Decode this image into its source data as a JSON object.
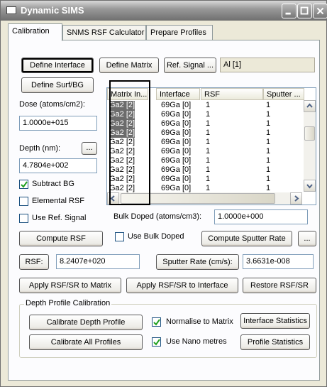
{
  "window": {
    "title": "Dynamic SIMS"
  },
  "tabs": [
    "Calibration",
    "SNMS RSF Calculator",
    "Prepare Profiles"
  ],
  "toolbar": {
    "define_interface": "Define Interface",
    "define_matrix": "Define Matrix",
    "ref_signal": "Ref. Signal ...",
    "ref_signal_value": "Al [1]",
    "define_surf_bg": "Define Surf/BG"
  },
  "left": {
    "dose_label": "Dose (atoms/cm2):",
    "dose_value": "1.0000e+015",
    "depth_label": "Depth (nm):",
    "depth_btn": "...",
    "depth_value": "4.7804e+002",
    "subtract_bg": "Subtract BG",
    "elemental_rsf": "Elemental RSF",
    "use_ref_signal": "Use Ref. Signal"
  },
  "table": {
    "headers": [
      "Matrix In...",
      "Interface",
      "RSF",
      "Sputter ..."
    ],
    "rows": [
      [
        "Ga2 [2]",
        "69Ga [0]",
        "1",
        "1"
      ],
      [
        "Ga2 [2]",
        "69Ga [0]",
        "1",
        "1"
      ],
      [
        "Ga2 [2]",
        "69Ga [0]",
        "1",
        "1"
      ],
      [
        "Ga2 [2]",
        "69Ga [0]",
        "1",
        "1"
      ],
      [
        "Ga2 [2]",
        "69Ga [0]",
        "1",
        "1"
      ],
      [
        "Ga2 [2]",
        "69Ga [0]",
        "1",
        "1"
      ],
      [
        "Ga2 [2]",
        "69Ga [0]",
        "1",
        "1"
      ],
      [
        "Ga2 [2]",
        "69Ga [0]",
        "1",
        "1"
      ],
      [
        "Ga2 [2]",
        "69Ga [0]",
        "1",
        "1"
      ],
      [
        "Ga2 [2]",
        "69Ga [0]",
        "1",
        "1"
      ]
    ]
  },
  "bulk": {
    "label": "Bulk Doped (atoms/cm3):",
    "value": "1.0000e+000",
    "compute_rsf": "Compute RSF",
    "use_bulk_doped": "Use Bulk Doped",
    "compute_sputter_rate": "Compute Sputter Rate",
    "more_btn": "..."
  },
  "rsf": {
    "label": "RSF:",
    "value": "8.2407e+020",
    "sputter_label": "Sputter Rate (cm/s):",
    "sputter_value": "3.6631e-008"
  },
  "apply": {
    "to_matrix": "Apply RSF/SR to Matrix",
    "to_interface": "Apply RSF/SR to Interface",
    "restore": "Restore RSF/SR"
  },
  "depth_calibration": {
    "legend": "Depth Profile Calibration",
    "calibrate_depth_profile": "Calibrate Depth Profile",
    "calibrate_all_profiles": "Calibrate All Profiles",
    "normalise_to_matrix": "Normalise to Matrix",
    "use_nano_metres": "Use Nano metres",
    "interface_statistics": "Interface Statistics",
    "profile_statistics": "Profile Statistics"
  }
}
